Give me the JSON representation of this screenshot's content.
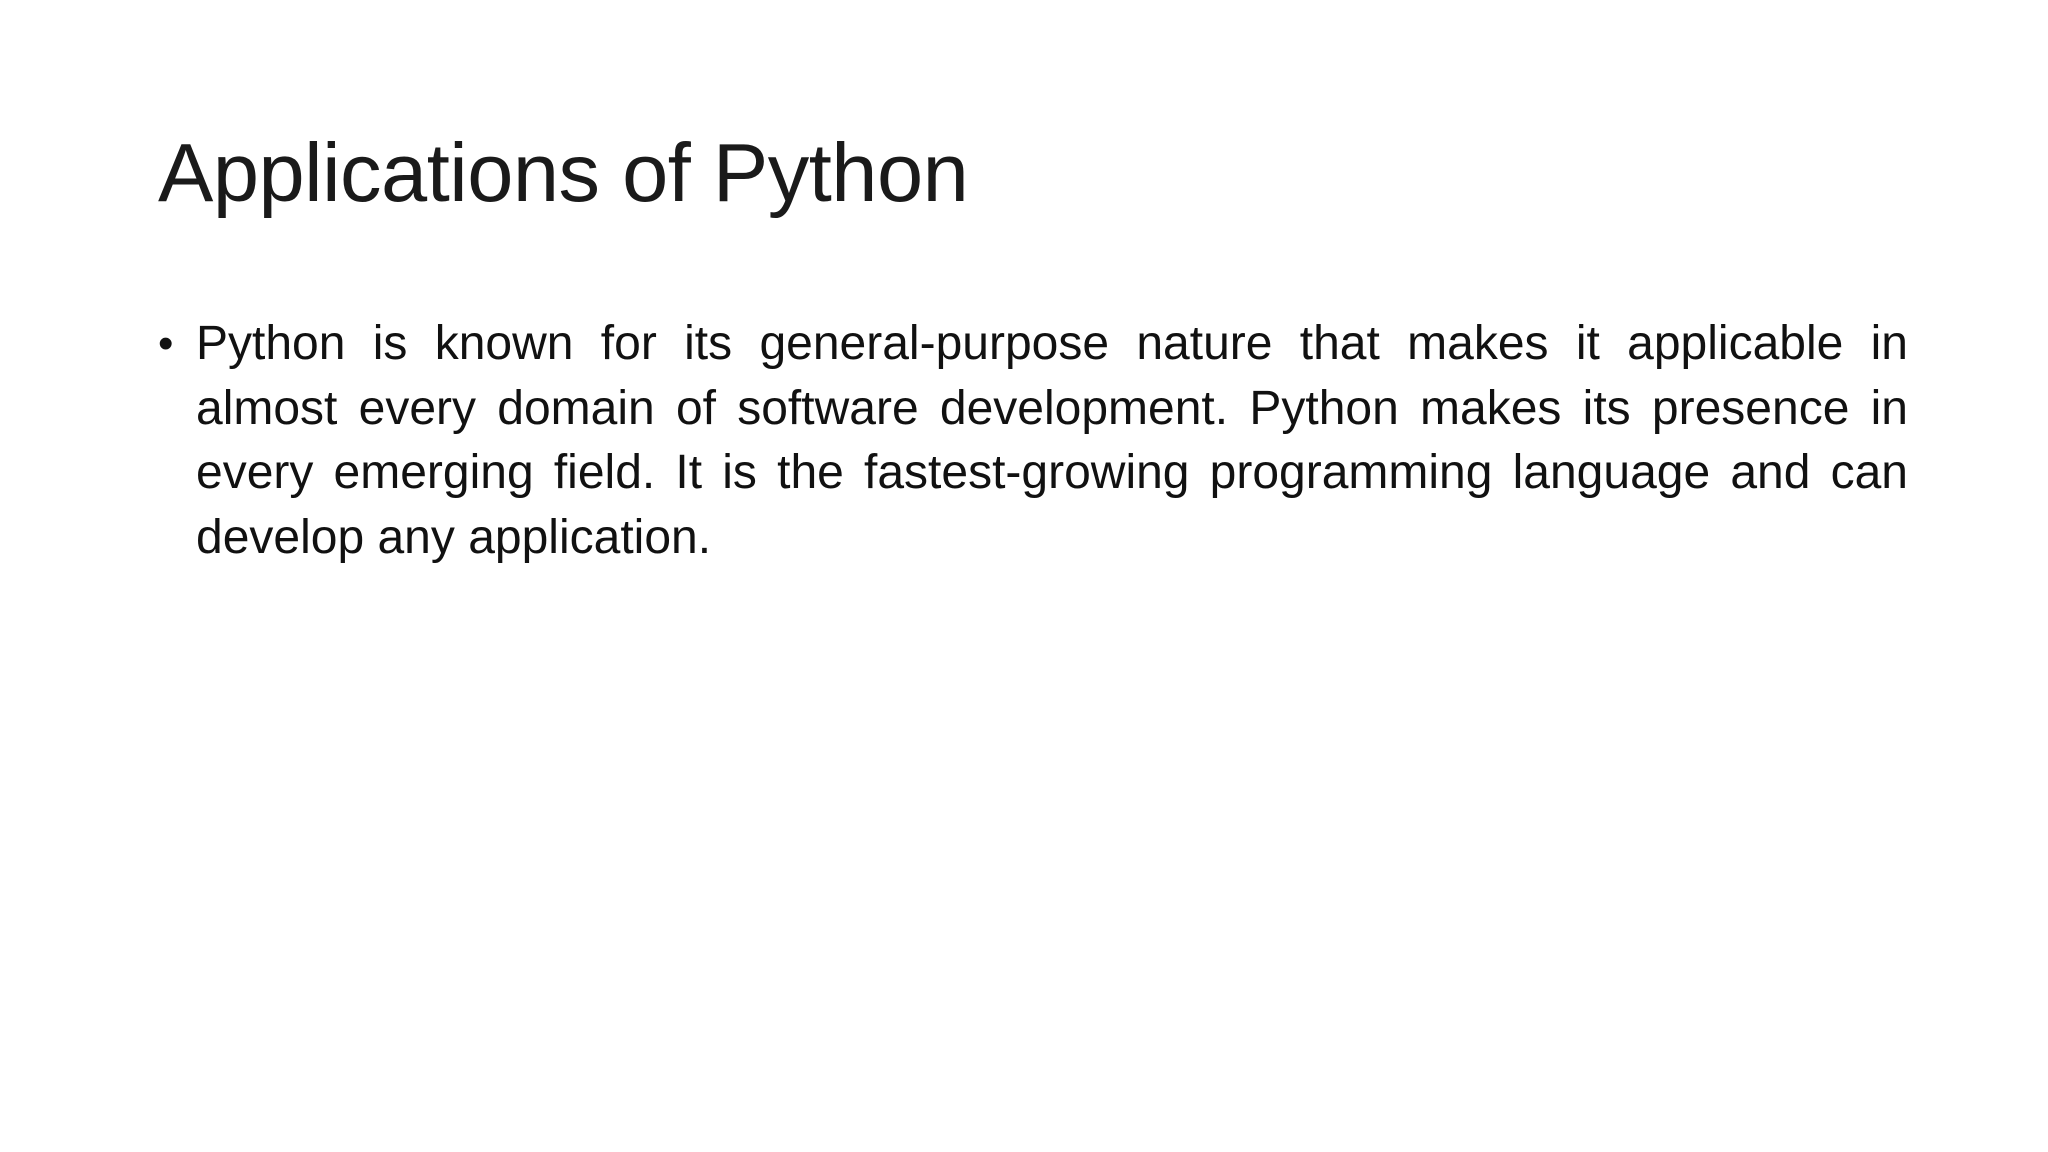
{
  "slide": {
    "title": "Applications of Python",
    "bullets": [
      {
        "marker": "•",
        "text": "Python is known for its general-purpose nature that makes it applicable in almost every domain of software development. Python makes its presence in every emerging field. It is the fastest-growing programming language and can develop any application."
      }
    ]
  },
  "colors": {
    "background": "#ffffff",
    "text": "#111111"
  }
}
